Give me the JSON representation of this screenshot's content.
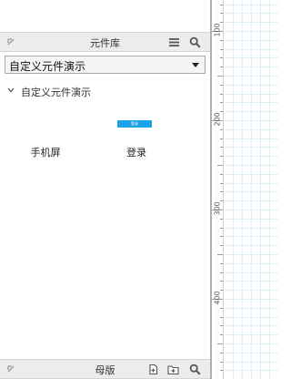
{
  "library_panel": {
    "title": "元件库",
    "selected_library": "自定义元件演示",
    "section_title": "自定义元件演示",
    "widgets": [
      {
        "label": "手机屏"
      },
      {
        "label": "登录",
        "thumb_text": "登录"
      }
    ]
  },
  "master_panel": {
    "title": "母版"
  },
  "ruler": {
    "labels": [
      "100",
      "200",
      "300",
      "400"
    ]
  },
  "colors": {
    "accent": "#1aa1e6",
    "header_bg": "#ececec",
    "grid_line": "#dcf0f8"
  },
  "icons": [
    "collapse-icon",
    "menu-icon",
    "search-icon",
    "dropdown-arrow-icon",
    "chevron-down-icon",
    "add-page-icon",
    "add-folder-icon"
  ]
}
